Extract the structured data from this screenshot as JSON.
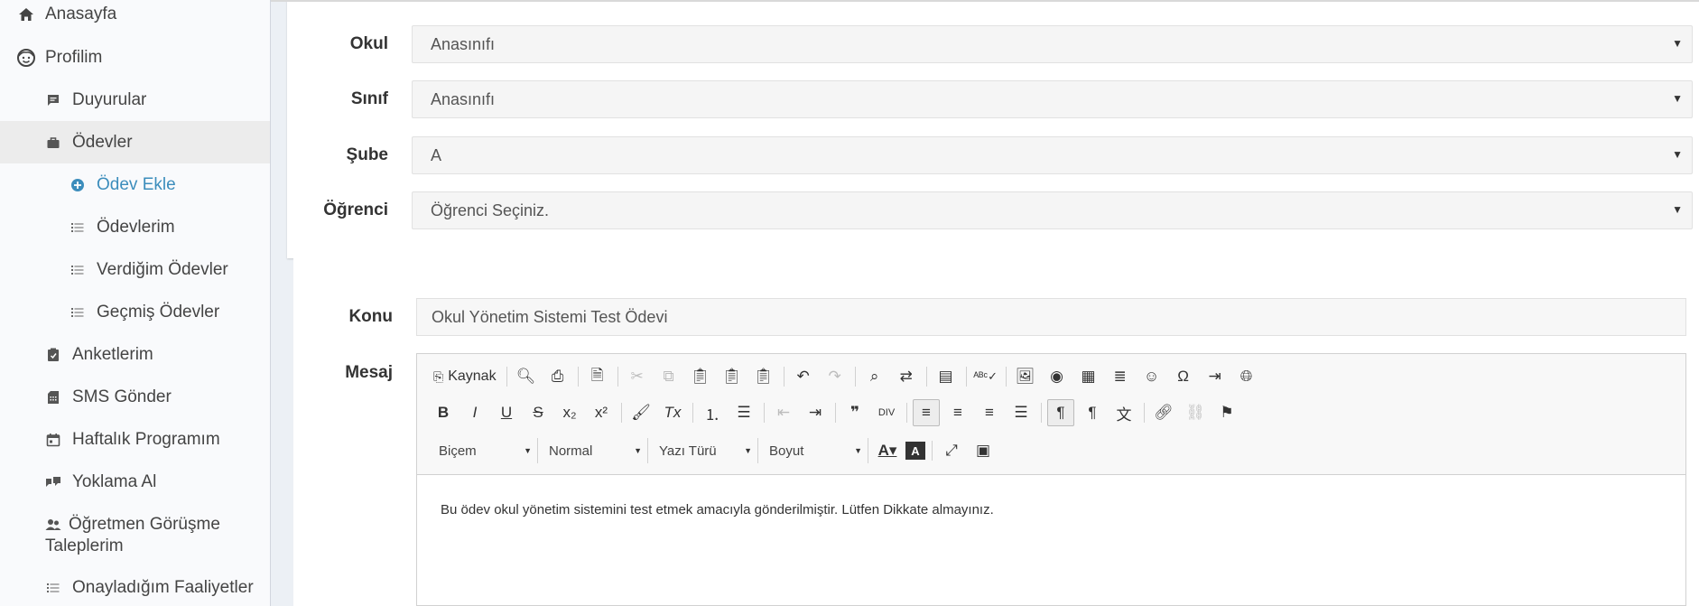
{
  "sidebar": {
    "items": [
      {
        "label": "Anasayfa",
        "icon": "home-icon"
      },
      {
        "label": "Profilim",
        "icon": "face-icon"
      },
      {
        "label": "Duyurular",
        "icon": "comment-icon"
      },
      {
        "label": "Ödevler",
        "icon": "briefcase-icon"
      },
      {
        "label": "Ödev Ekle",
        "icon": "plus-circle-icon"
      },
      {
        "label": "Ödevlerim",
        "icon": "list-icon"
      },
      {
        "label": "Verdiğim Ödevler",
        "icon": "list-icon"
      },
      {
        "label": "Geçmiş Ödevler",
        "icon": "list-icon"
      },
      {
        "label": "Anketlerim",
        "icon": "poll-icon"
      },
      {
        "label": "SMS Gönder",
        "icon": "sms-icon"
      },
      {
        "label": "Haftalık Programım",
        "icon": "calendar-icon"
      },
      {
        "label": "Yoklama Al",
        "icon": "checkin-icon"
      },
      {
        "label": "Öğretmen Görüşme Taleplerim",
        "label_line1": "Öğretmen Görüşme",
        "label_line2": "Taleplerim",
        "icon": "people-icon"
      },
      {
        "label": "Onayladığım Faaliyetler",
        "icon": "list-icon"
      }
    ]
  },
  "form": {
    "okul": {
      "label": "Okul",
      "value": "Anasınıfı"
    },
    "sinif": {
      "label": "Sınıf",
      "value": "Anasınıfı"
    },
    "sube": {
      "label": "Şube",
      "value": "A"
    },
    "ogrenci": {
      "label": "Öğrenci",
      "placeholder": "Öğrenci Seçiniz."
    },
    "konu": {
      "label": "Konu",
      "value": "Okul Yönetim Sistemi Test Ödevi"
    },
    "mesaj": {
      "label": "Mesaj"
    }
  },
  "editor": {
    "source_label": "Kaynak",
    "format_combo": "Biçem",
    "style_combo": "Normal",
    "font_combo": "Yazı Türü",
    "size_combo": "Boyut",
    "content": "Bu ödev okul yönetim sistemini test etmek amacıyla gönderilmiştir. Lütfen Dikkate almayınız."
  },
  "colors": {
    "accent": "#3c8dbc",
    "sidebar_bg": "#f9fafc",
    "page_bg": "#ecf0f5"
  }
}
